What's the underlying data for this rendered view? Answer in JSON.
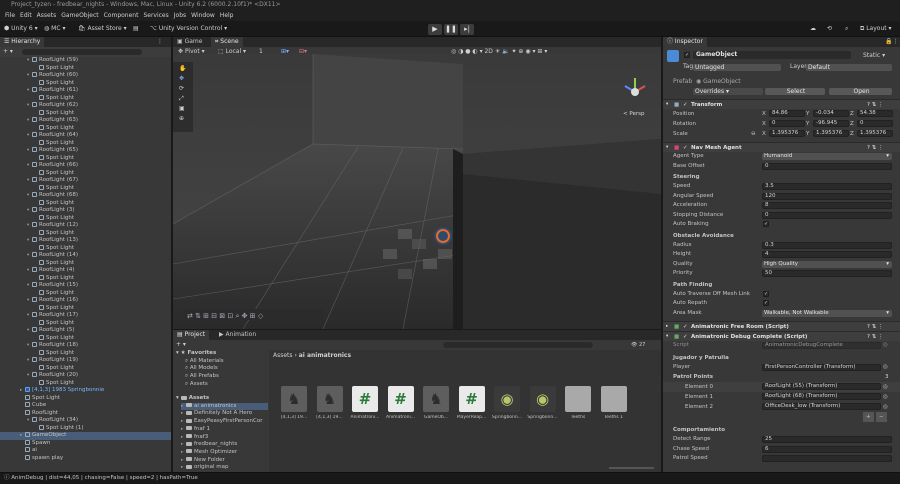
{
  "window": {
    "title": "Project_tyzen - fredbear_nights - Windows, Mac, Linux - Unity 6.2 (6000.2.10f1)* <DX11>"
  },
  "menu": [
    "File",
    "Edit",
    "Assets",
    "GameObject",
    "Component",
    "Services",
    "Jobs",
    "Window",
    "Help"
  ],
  "toolbar": {
    "account": "Unity 6",
    "mc": "MC",
    "asset_store": "Asset Store",
    "version_control": "Unity Version Control",
    "layout": "Layout"
  },
  "hierarchy": {
    "tab": "Hierarchy",
    "rows": [
      {
        "label": "RoofLight (59)",
        "depth": 1,
        "type": "group"
      },
      {
        "label": "Spot Light",
        "depth": 2,
        "type": "leaf"
      },
      {
        "label": "RoofLight (60)",
        "depth": 1,
        "type": "group"
      },
      {
        "label": "Spot Light",
        "depth": 2,
        "type": "leaf"
      },
      {
        "label": "RoofLight (61)",
        "depth": 1,
        "type": "group"
      },
      {
        "label": "Spot Light",
        "depth": 2,
        "type": "leaf"
      },
      {
        "label": "RoofLight (62)",
        "depth": 1,
        "type": "group"
      },
      {
        "label": "Spot Light",
        "depth": 2,
        "type": "leaf"
      },
      {
        "label": "RoofLight (63)",
        "depth": 1,
        "type": "group"
      },
      {
        "label": "Spot Light",
        "depth": 2,
        "type": "leaf"
      },
      {
        "label": "RoofLight (64)",
        "depth": 1,
        "type": "group"
      },
      {
        "label": "Spot Light",
        "depth": 2,
        "type": "leaf"
      },
      {
        "label": "RoofLight (65)",
        "depth": 1,
        "type": "group"
      },
      {
        "label": "Spot Light",
        "depth": 2,
        "type": "leaf"
      },
      {
        "label": "RoofLight (66)",
        "depth": 1,
        "type": "group"
      },
      {
        "label": "Spot Light",
        "depth": 2,
        "type": "leaf"
      },
      {
        "label": "RoofLight (67)",
        "depth": 1,
        "type": "group"
      },
      {
        "label": "Spot Light",
        "depth": 2,
        "type": "leaf"
      },
      {
        "label": "RoofLight (68)",
        "depth": 1,
        "type": "group"
      },
      {
        "label": "Spot Light",
        "depth": 2,
        "type": "leaf"
      },
      {
        "label": "RoofLight (3)",
        "depth": 1,
        "type": "group"
      },
      {
        "label": "Spot Light",
        "depth": 2,
        "type": "leaf"
      },
      {
        "label": "RoofLight (12)",
        "depth": 1,
        "type": "group"
      },
      {
        "label": "Spot Light",
        "depth": 2,
        "type": "leaf"
      },
      {
        "label": "RoofLight (13)",
        "depth": 1,
        "type": "group"
      },
      {
        "label": "Spot Light",
        "depth": 2,
        "type": "leaf"
      },
      {
        "label": "RoofLight (14)",
        "depth": 1,
        "type": "group"
      },
      {
        "label": "Spot Light",
        "depth": 2,
        "type": "leaf"
      },
      {
        "label": "RoofLight (4)",
        "depth": 1,
        "type": "group"
      },
      {
        "label": "Spot Light",
        "depth": 2,
        "type": "leaf"
      },
      {
        "label": "RoofLight (15)",
        "depth": 1,
        "type": "group"
      },
      {
        "label": "Spot Light",
        "depth": 2,
        "type": "leaf"
      },
      {
        "label": "RoofLight (16)",
        "depth": 1,
        "type": "group"
      },
      {
        "label": "Spot Light",
        "depth": 2,
        "type": "leaf"
      },
      {
        "label": "RoofLight (17)",
        "depth": 1,
        "type": "group"
      },
      {
        "label": "Spot Light",
        "depth": 2,
        "type": "leaf"
      },
      {
        "label": "RoofLight (5)",
        "depth": 1,
        "type": "group"
      },
      {
        "label": "Spot Light",
        "depth": 2,
        "type": "leaf"
      },
      {
        "label": "RoofLight (18)",
        "depth": 1,
        "type": "group"
      },
      {
        "label": "Spot Light",
        "depth": 2,
        "type": "leaf"
      },
      {
        "label": "RoofLight (19)",
        "depth": 1,
        "type": "group"
      },
      {
        "label": "Spot Light",
        "depth": 2,
        "type": "leaf"
      },
      {
        "label": "RoofLight (20)",
        "depth": 1,
        "type": "group"
      },
      {
        "label": "Spot Light",
        "depth": 2,
        "type": "leaf"
      },
      {
        "label": "[4,1,3] 1983 Springbonnie",
        "depth": 0,
        "type": "prefab"
      },
      {
        "label": "Spot Light",
        "depth": 0,
        "type": "leaf"
      },
      {
        "label": "Cube",
        "depth": 0,
        "type": "leaf"
      },
      {
        "label": "RoofLight",
        "depth": 0,
        "type": "leaf"
      },
      {
        "label": "RoofLight (34)",
        "depth": 1,
        "type": "group"
      },
      {
        "label": "Spot Light (1)",
        "depth": 2,
        "type": "leaf"
      },
      {
        "label": "GameObject",
        "depth": 0,
        "type": "selected"
      },
      {
        "label": "Spawn",
        "depth": 0,
        "type": "leaf"
      },
      {
        "label": "ai",
        "depth": 0,
        "type": "leaf"
      },
      {
        "label": "spawn play",
        "depth": 0,
        "type": "leaf"
      }
    ]
  },
  "scene": {
    "tabs": [
      "Game",
      "Scene"
    ],
    "pivot": "Pivot",
    "local": "Local",
    "grid": "1",
    "persp": "< Persp"
  },
  "project": {
    "tabs": [
      "Project",
      "Animation"
    ],
    "favorites": {
      "title": "Favorites",
      "items": [
        "All Materials",
        "All Models",
        "All Prefabs",
        "Assets"
      ]
    },
    "assets_tree": {
      "title": "Assets",
      "items": [
        "ai animatronics",
        "Definitely Not A Hero",
        "EasyPeasyFirstPersonCor",
        "fnaf 1",
        "fnaf3",
        "fredbear_nights",
        "Mesh Optimizer",
        "New Folder",
        "original map",
        "OutdoorScene"
      ]
    },
    "breadcrumb": [
      "Assets",
      "ai animatronics"
    ],
    "count": "27",
    "assets": [
      {
        "name": "[4,1,3] 19...",
        "kind": "model"
      },
      {
        "name": "[4,1,3] 19...",
        "kind": "model"
      },
      {
        "name": "Animatroni...",
        "kind": "script"
      },
      {
        "name": "Animatroni...",
        "kind": "script"
      },
      {
        "name": "GameOb...",
        "kind": "model"
      },
      {
        "name": "PlayerReap...",
        "kind": "script"
      },
      {
        "name": "Springbonn...",
        "kind": "eye"
      },
      {
        "name": "Springbonn...",
        "kind": "eye"
      },
      {
        "name": "Teeths",
        "kind": "tex"
      },
      {
        "name": "Teeths 1",
        "kind": "tex"
      }
    ]
  },
  "inspector": {
    "tab": "Inspector",
    "name": "GameObject",
    "static": "Static",
    "tag_label": "Tag",
    "tag": "Untagged",
    "layer_label": "Layer",
    "layer": "Default",
    "prefab_label": "Prefab",
    "prefab": "GameObject",
    "overrides": "Overrides",
    "select": "Select",
    "open": "Open",
    "transform": {
      "title": "Transform",
      "rows": [
        {
          "label": "Position",
          "x": "84.86",
          "y": "-0.034",
          "z": "54.38"
        },
        {
          "label": "Rotation",
          "x": "0",
          "y": "-96.945",
          "z": "0"
        },
        {
          "label": "Scale",
          "x": "1.395376",
          "y": "1.395376",
          "z": "1.395376"
        }
      ]
    },
    "navmesh": {
      "title": "Nav Mesh Agent",
      "agent_type_label": "Agent Type",
      "agent_type": "Humanoid",
      "base_offset_label": "Base Offset",
      "base_offset": "0",
      "steering": "Steering",
      "speed_label": "Speed",
      "speed": "3.5",
      "angular_label": "Angular Speed",
      "angular": "120",
      "accel_label": "Acceleration",
      "accel": "8",
      "stopping_label": "Stopping Distance",
      "stopping": "0",
      "autobrake_label": "Auto Braking",
      "obstacle": "Obstacle Avoidance",
      "radius_label": "Radius",
      "radius": "0.3",
      "height_label": "Height",
      "height": "4",
      "quality_label": "Quality",
      "quality": "High Quality",
      "priority_label": "Priority",
      "priority": "50",
      "pathfinding": "Path Finding",
      "traverse_label": "Auto Traverse Off Mesh Link",
      "repath_label": "Auto Repath",
      "area_label": "Area Mask",
      "area": "Walkable, Not Walkable"
    },
    "free_roam": "Animatronic Free Room (Script)",
    "debug": {
      "title": "Animatronic Debug Complete (Script)",
      "script_label": "Script",
      "script": "AnimatronicDebugComplete",
      "section": "Jugador y Patrulla",
      "player_label": "Player",
      "player": "FirstPersonController (Transform)",
      "patrol_label": "Patrol Points",
      "patrol_count": "3",
      "elements": [
        {
          "label": "Element 0",
          "value": "RoofLight (55) (Transform)"
        },
        {
          "label": "Element 1",
          "value": "RoofLight (68) (Transform)"
        },
        {
          "label": "Element 2",
          "value": "OfficeDesk_low (Transform)"
        }
      ],
      "behavior": "Comportamiento",
      "detect_label": "Detect Range",
      "detect": "25",
      "chase_label": "Chase Speed",
      "chase": "6",
      "patrol_speed_label": "Patrol Speed"
    }
  },
  "status": "AnimDebug | dist=44,05 | chasing=False | speed=2 | hasPath=True"
}
